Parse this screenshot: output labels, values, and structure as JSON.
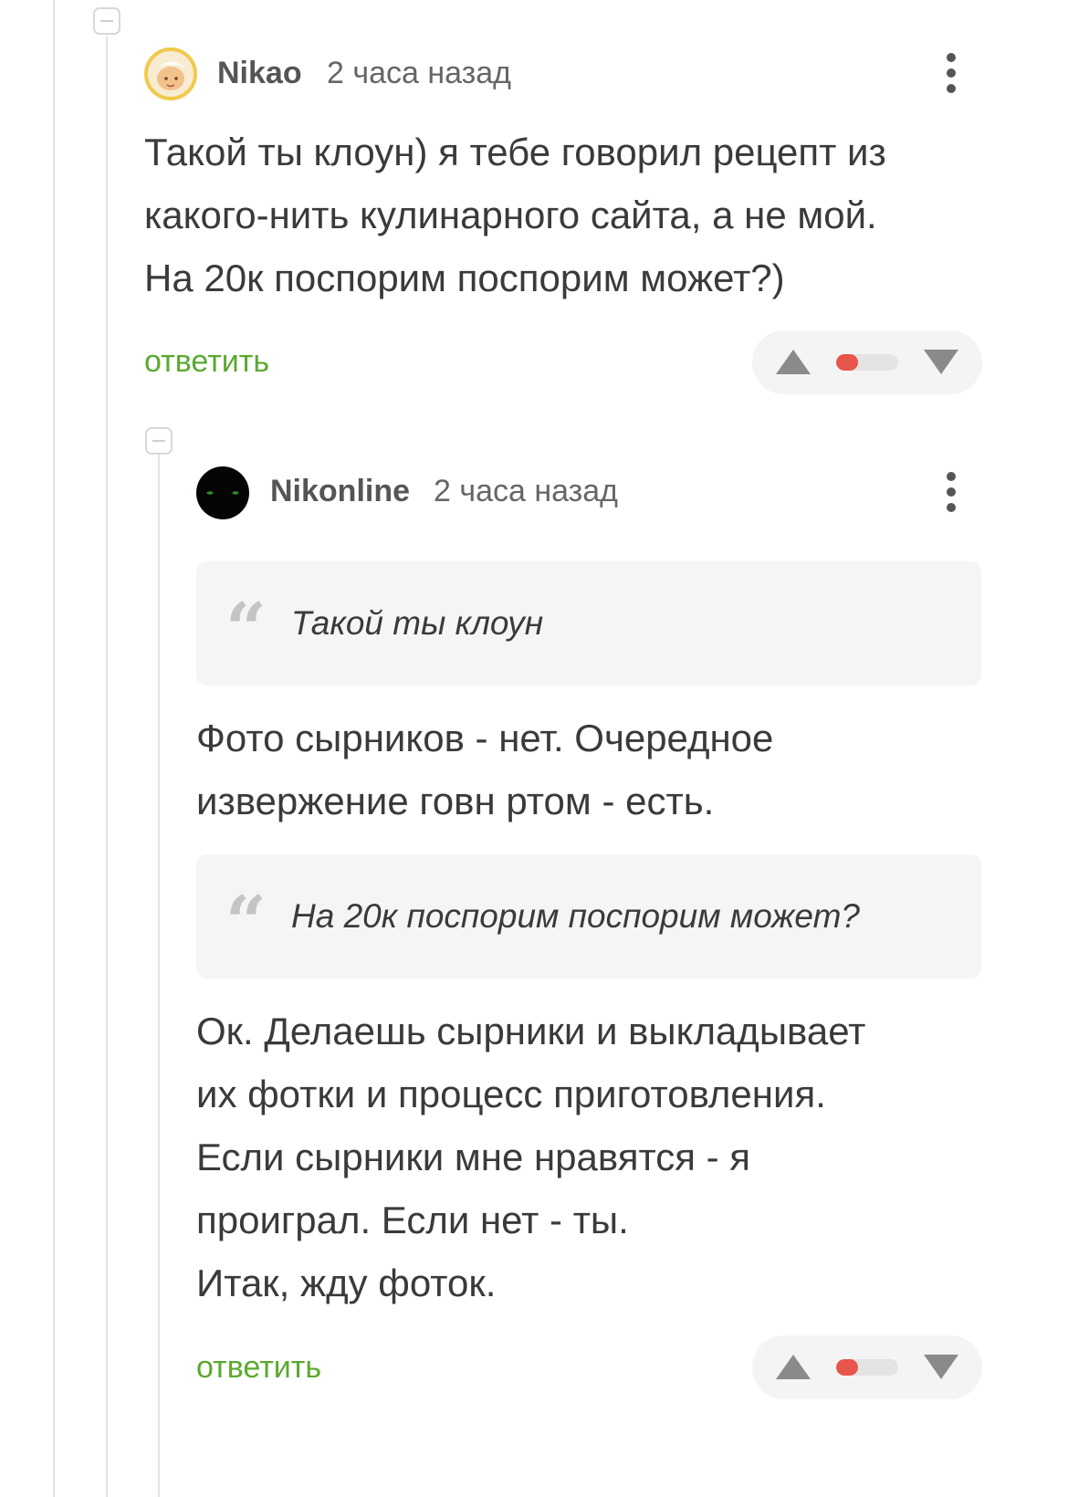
{
  "thread": {
    "comments": [
      {
        "author": "Nikao",
        "time": "2 часа назад",
        "avatar_icon": "avatar-nikao-icon",
        "text": "Такой ты клоун) я тебе говорил рецепт из\nкакого-нить кулинарного сайта, а не мой.\nНа 20к поспорим поспорим может?)",
        "reply_label": "ответить",
        "rating_positive_share": 0.35
      },
      {
        "author": "Nikonline",
        "time": "2 часа назад",
        "avatar_icon": "avatar-nikonline-icon",
        "quote1": "Такой ты клоун",
        "text1": "Фото сырников - нет. Очередное\nизвержение говн ртом - есть.",
        "quote2": "На 20к поспорим поспорим может?",
        "text2": "Ок. Делаешь сырники и выкладывает\nих фотки и процесс приготовления.\nЕсли сырники мне нравятся - я\nпроиграл. Если нет - ты.\nИтак, жду фоток.",
        "reply_label": "ответить",
        "rating_positive_share": 0.35
      }
    ]
  },
  "colors": {
    "reply_link": "#5ba930",
    "rating_negative": "#e8554b",
    "rating_track": "#e4e4e4",
    "quote_bg": "#f5f5f5",
    "avatar_ring": "#f2c94c"
  }
}
